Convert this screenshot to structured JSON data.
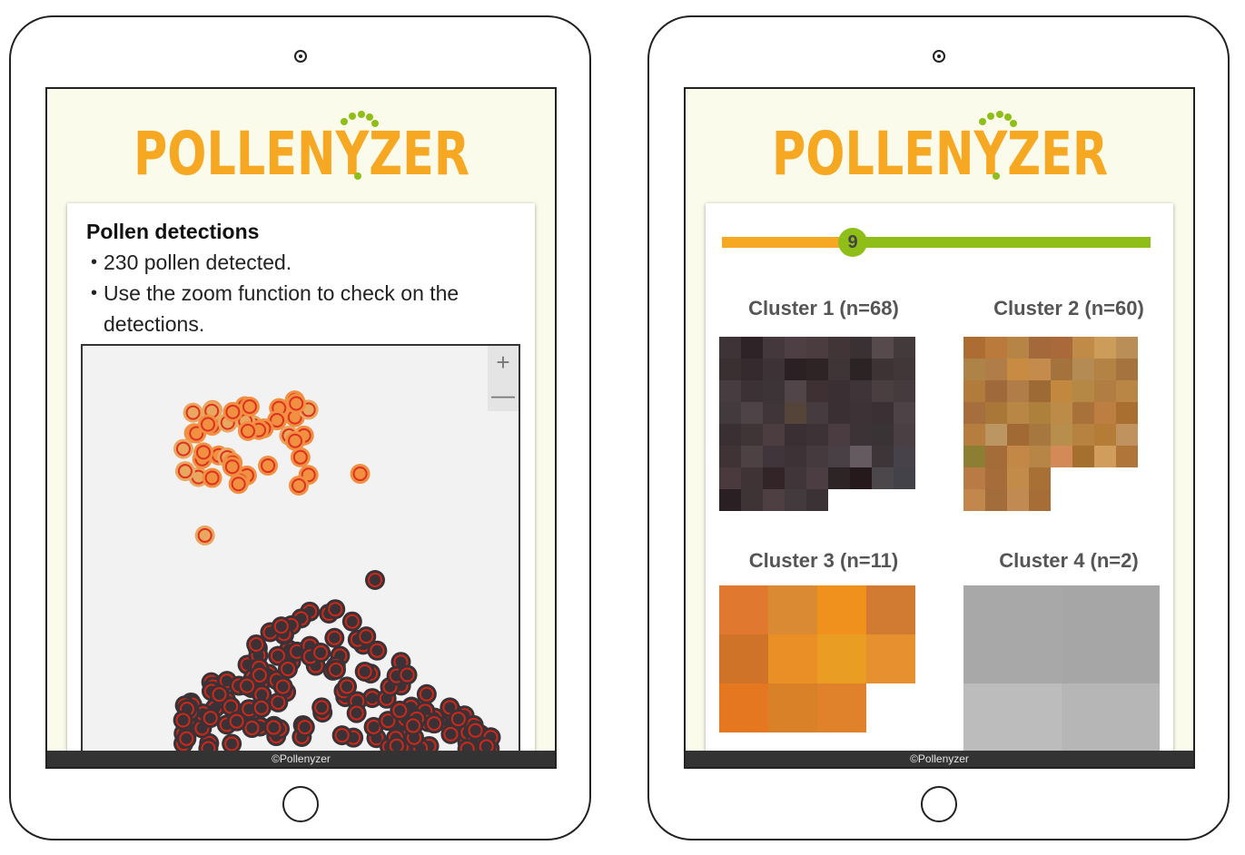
{
  "brand": {
    "logo_text": "POLLENYZER",
    "orange": "#f7a823",
    "green": "#8fbe19"
  },
  "footer_text": "©Pollenyzer",
  "left_screen": {
    "title": "Pollen detections",
    "bullets": [
      "230 pollen detected.",
      "Use the zoom function to check on the detections."
    ],
    "zoom": {
      "in_label": "+",
      "out_label": "—"
    }
  },
  "right_screen": {
    "slider_value": "9",
    "clusters": [
      {
        "label": "Cluster 1 (n=68)",
        "cols": 9,
        "count": 68,
        "colors": [
          "#3e3336",
          "#2e2428",
          "#45383c",
          "#4d3f43",
          "#4a3c3f",
          "#413538",
          "#3a3134",
          "#564a4d",
          "#433a3c",
          "#3a2f31",
          "#352a2d",
          "#3d3336",
          "#2b2124",
          "#2e2426",
          "#3f3537",
          "#2c2325",
          "#3d3335",
          "#413739",
          "#473d40",
          "#3c3235",
          "#3d3438",
          "#524549",
          "#3e3033",
          "#3a3034",
          "#3f3437",
          "#4b3e41",
          "#453b3e",
          "#433a3d",
          "#4e4346",
          "#403538",
          "#554439",
          "#463b3e",
          "#3a3034",
          "#3d3235",
          "#3b3134",
          "#4d4346",
          "#3a2f32",
          "#3f3537",
          "#4c3d40",
          "#3a3033",
          "#3d3236",
          "#4a3c40",
          "#3c3336",
          "#393336",
          "#4a3f43",
          "#3f3336",
          "#4e4144",
          "#40353a",
          "#3d3336",
          "#453a3d",
          "#484045",
          "#655a5f",
          "#3e3539",
          "#474249",
          "#4a3a3d",
          "#3f3336",
          "#332428",
          "#403538",
          "#4b3d41",
          "#2d2426",
          "#25191c",
          "#4b474a",
          "#434248",
          "#2a2024",
          "#3e3335",
          "#4d3f42",
          "#433a3d",
          "#3b3236"
        ]
      },
      {
        "label": "Cluster 2 (n=60)",
        "cols": 9,
        "count": 60,
        "colors": [
          "#ad6c32",
          "#b97a3c",
          "#b68545",
          "#a4693a",
          "#a9693a",
          "#c08a47",
          "#cc9d5a",
          "#b98e57",
          "#ffffff",
          "#ad8347",
          "#b07d49",
          "#c78b42",
          "#c48b4c",
          "#a4733d",
          "#b38b53",
          "#b38346",
          "#a5743e",
          "#ffffff",
          "#b17c3b",
          "#a0693b",
          "#b07c47",
          "#9d6a36",
          "#c38840",
          "#b68845",
          "#b17d42",
          "#b98645",
          "#ffffff",
          "#a66d3d",
          "#a97838",
          "#b88745",
          "#ad803b",
          "#bb8b47",
          "#a87139",
          "#bc7e41",
          "#a96f30",
          "#ffffff",
          "#b67e3e",
          "#bb9562",
          "#a16a34",
          "#a6783f",
          "#b78e4b",
          "#b7813f",
          "#b47c36",
          "#c0925e",
          "#ffffff",
          "#8c7e33",
          "#a36c38",
          "#c38848",
          "#b78646",
          "#d48a56",
          "#a5702e",
          "#d19d5c",
          "#b07539",
          "#ffffff",
          "#b87b46",
          "#a66d3b",
          "#c38b49",
          "#a97035",
          "#ffffff",
          "#ffffff",
          "#ffffff",
          "#ffffff",
          "#ffffff",
          "#c2874d",
          "#a26d3b",
          "#c18a52",
          "#a66d36"
        ]
      },
      {
        "label": "Cluster 3 (n=11)",
        "cols": 4,
        "count": 11,
        "colors": [
          "#e0792f",
          "#db8a34",
          "#f0901d",
          "#d07a32",
          "#cf7329",
          "#e98f26",
          "#e99d23",
          "#e79030",
          "#e57720",
          "#d88128",
          "#e0822c"
        ]
      },
      {
        "label": "Cluster 4 (n=2)",
        "cols": 2,
        "count": 4,
        "colors": [
          "#a8a8a8",
          "#a6a6a6",
          "#bcbcbc",
          "#b6b6b6"
        ]
      }
    ]
  }
}
